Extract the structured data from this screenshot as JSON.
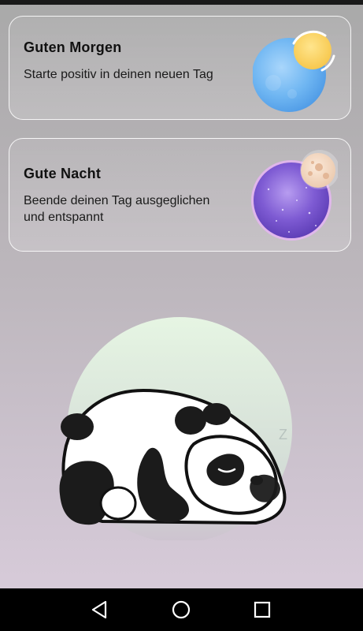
{
  "cards": [
    {
      "title": "Guten Morgen",
      "subtitle": "Starte positiv in deinen neuen Tag",
      "icon": "sun-planet-icon"
    },
    {
      "title": "Gute Nacht",
      "subtitle": "Beende deinen Tag ausgeglichen und entspannt",
      "icon": "moon-planet-icon"
    }
  ],
  "illustration": {
    "icon": "sleeping-panda",
    "sleep_mark": "Z"
  },
  "navbar": {
    "back": "back-icon",
    "home": "home-icon",
    "recent": "recent-apps-icon"
  },
  "colors": {
    "sun_planet": "#6fb6f2",
    "sun": "#ffd66b",
    "night_planet": "#7e5bd3",
    "moon": "#f3dcc7",
    "glow": "#e6f5e3"
  }
}
